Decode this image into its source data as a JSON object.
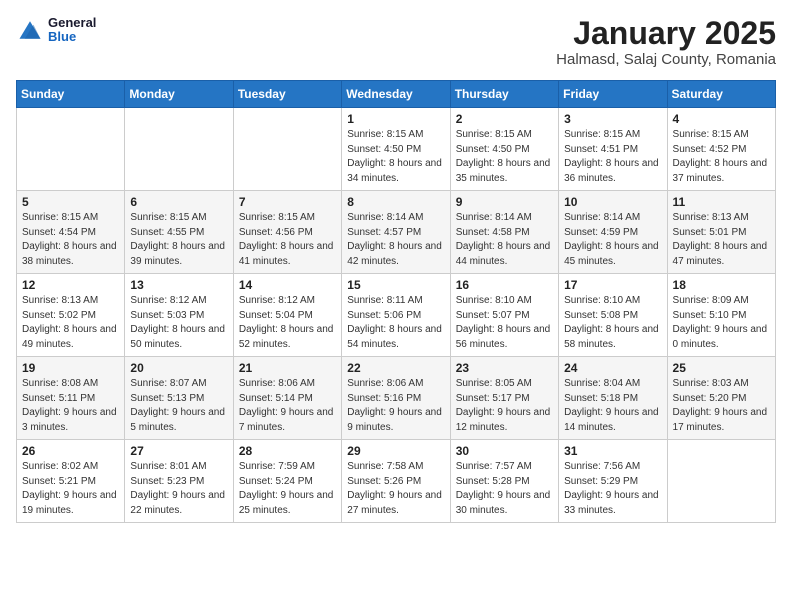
{
  "logo": {
    "general": "General",
    "blue": "Blue"
  },
  "title": "January 2025",
  "location": "Halmasd, Salaj County, Romania",
  "weekdays": [
    "Sunday",
    "Monday",
    "Tuesday",
    "Wednesday",
    "Thursday",
    "Friday",
    "Saturday"
  ],
  "weeks": [
    [
      {
        "day": "",
        "sunrise": "",
        "sunset": "",
        "daylight": ""
      },
      {
        "day": "",
        "sunrise": "",
        "sunset": "",
        "daylight": ""
      },
      {
        "day": "",
        "sunrise": "",
        "sunset": "",
        "daylight": ""
      },
      {
        "day": "1",
        "sunrise": "Sunrise: 8:15 AM",
        "sunset": "Sunset: 4:50 PM",
        "daylight": "Daylight: 8 hours and 34 minutes."
      },
      {
        "day": "2",
        "sunrise": "Sunrise: 8:15 AM",
        "sunset": "Sunset: 4:50 PM",
        "daylight": "Daylight: 8 hours and 35 minutes."
      },
      {
        "day": "3",
        "sunrise": "Sunrise: 8:15 AM",
        "sunset": "Sunset: 4:51 PM",
        "daylight": "Daylight: 8 hours and 36 minutes."
      },
      {
        "day": "4",
        "sunrise": "Sunrise: 8:15 AM",
        "sunset": "Sunset: 4:52 PM",
        "daylight": "Daylight: 8 hours and 37 minutes."
      }
    ],
    [
      {
        "day": "5",
        "sunrise": "Sunrise: 8:15 AM",
        "sunset": "Sunset: 4:54 PM",
        "daylight": "Daylight: 8 hours and 38 minutes."
      },
      {
        "day": "6",
        "sunrise": "Sunrise: 8:15 AM",
        "sunset": "Sunset: 4:55 PM",
        "daylight": "Daylight: 8 hours and 39 minutes."
      },
      {
        "day": "7",
        "sunrise": "Sunrise: 8:15 AM",
        "sunset": "Sunset: 4:56 PM",
        "daylight": "Daylight: 8 hours and 41 minutes."
      },
      {
        "day": "8",
        "sunrise": "Sunrise: 8:14 AM",
        "sunset": "Sunset: 4:57 PM",
        "daylight": "Daylight: 8 hours and 42 minutes."
      },
      {
        "day": "9",
        "sunrise": "Sunrise: 8:14 AM",
        "sunset": "Sunset: 4:58 PM",
        "daylight": "Daylight: 8 hours and 44 minutes."
      },
      {
        "day": "10",
        "sunrise": "Sunrise: 8:14 AM",
        "sunset": "Sunset: 4:59 PM",
        "daylight": "Daylight: 8 hours and 45 minutes."
      },
      {
        "day": "11",
        "sunrise": "Sunrise: 8:13 AM",
        "sunset": "Sunset: 5:01 PM",
        "daylight": "Daylight: 8 hours and 47 minutes."
      }
    ],
    [
      {
        "day": "12",
        "sunrise": "Sunrise: 8:13 AM",
        "sunset": "Sunset: 5:02 PM",
        "daylight": "Daylight: 8 hours and 49 minutes."
      },
      {
        "day": "13",
        "sunrise": "Sunrise: 8:12 AM",
        "sunset": "Sunset: 5:03 PM",
        "daylight": "Daylight: 8 hours and 50 minutes."
      },
      {
        "day": "14",
        "sunrise": "Sunrise: 8:12 AM",
        "sunset": "Sunset: 5:04 PM",
        "daylight": "Daylight: 8 hours and 52 minutes."
      },
      {
        "day": "15",
        "sunrise": "Sunrise: 8:11 AM",
        "sunset": "Sunset: 5:06 PM",
        "daylight": "Daylight: 8 hours and 54 minutes."
      },
      {
        "day": "16",
        "sunrise": "Sunrise: 8:10 AM",
        "sunset": "Sunset: 5:07 PM",
        "daylight": "Daylight: 8 hours and 56 minutes."
      },
      {
        "day": "17",
        "sunrise": "Sunrise: 8:10 AM",
        "sunset": "Sunset: 5:08 PM",
        "daylight": "Daylight: 8 hours and 58 minutes."
      },
      {
        "day": "18",
        "sunrise": "Sunrise: 8:09 AM",
        "sunset": "Sunset: 5:10 PM",
        "daylight": "Daylight: 9 hours and 0 minutes."
      }
    ],
    [
      {
        "day": "19",
        "sunrise": "Sunrise: 8:08 AM",
        "sunset": "Sunset: 5:11 PM",
        "daylight": "Daylight: 9 hours and 3 minutes."
      },
      {
        "day": "20",
        "sunrise": "Sunrise: 8:07 AM",
        "sunset": "Sunset: 5:13 PM",
        "daylight": "Daylight: 9 hours and 5 minutes."
      },
      {
        "day": "21",
        "sunrise": "Sunrise: 8:06 AM",
        "sunset": "Sunset: 5:14 PM",
        "daylight": "Daylight: 9 hours and 7 minutes."
      },
      {
        "day": "22",
        "sunrise": "Sunrise: 8:06 AM",
        "sunset": "Sunset: 5:16 PM",
        "daylight": "Daylight: 9 hours and 9 minutes."
      },
      {
        "day": "23",
        "sunrise": "Sunrise: 8:05 AM",
        "sunset": "Sunset: 5:17 PM",
        "daylight": "Daylight: 9 hours and 12 minutes."
      },
      {
        "day": "24",
        "sunrise": "Sunrise: 8:04 AM",
        "sunset": "Sunset: 5:18 PM",
        "daylight": "Daylight: 9 hours and 14 minutes."
      },
      {
        "day": "25",
        "sunrise": "Sunrise: 8:03 AM",
        "sunset": "Sunset: 5:20 PM",
        "daylight": "Daylight: 9 hours and 17 minutes."
      }
    ],
    [
      {
        "day": "26",
        "sunrise": "Sunrise: 8:02 AM",
        "sunset": "Sunset: 5:21 PM",
        "daylight": "Daylight: 9 hours and 19 minutes."
      },
      {
        "day": "27",
        "sunrise": "Sunrise: 8:01 AM",
        "sunset": "Sunset: 5:23 PM",
        "daylight": "Daylight: 9 hours and 22 minutes."
      },
      {
        "day": "28",
        "sunrise": "Sunrise: 7:59 AM",
        "sunset": "Sunset: 5:24 PM",
        "daylight": "Daylight: 9 hours and 25 minutes."
      },
      {
        "day": "29",
        "sunrise": "Sunrise: 7:58 AM",
        "sunset": "Sunset: 5:26 PM",
        "daylight": "Daylight: 9 hours and 27 minutes."
      },
      {
        "day": "30",
        "sunrise": "Sunrise: 7:57 AM",
        "sunset": "Sunset: 5:28 PM",
        "daylight": "Daylight: 9 hours and 30 minutes."
      },
      {
        "day": "31",
        "sunrise": "Sunrise: 7:56 AM",
        "sunset": "Sunset: 5:29 PM",
        "daylight": "Daylight: 9 hours and 33 minutes."
      },
      {
        "day": "",
        "sunrise": "",
        "sunset": "",
        "daylight": ""
      }
    ]
  ]
}
